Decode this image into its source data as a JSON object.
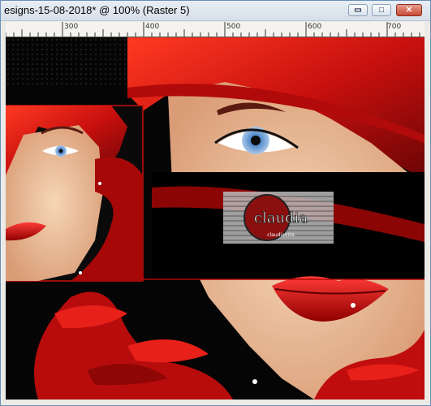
{
  "window": {
    "title": "esigns-15-08-2018* @ 100% (Raster 5)",
    "buttons": {
      "minimize": "▭",
      "maximize": "□",
      "close": "✕"
    }
  },
  "ruler": {
    "labels": [
      "300",
      "400",
      "500",
      "600",
      "700"
    ]
  },
  "canvas": {
    "watermark": {
      "name": "claudia",
      "sub": "claudiaviza"
    },
    "accent_color": "#c8100e"
  }
}
